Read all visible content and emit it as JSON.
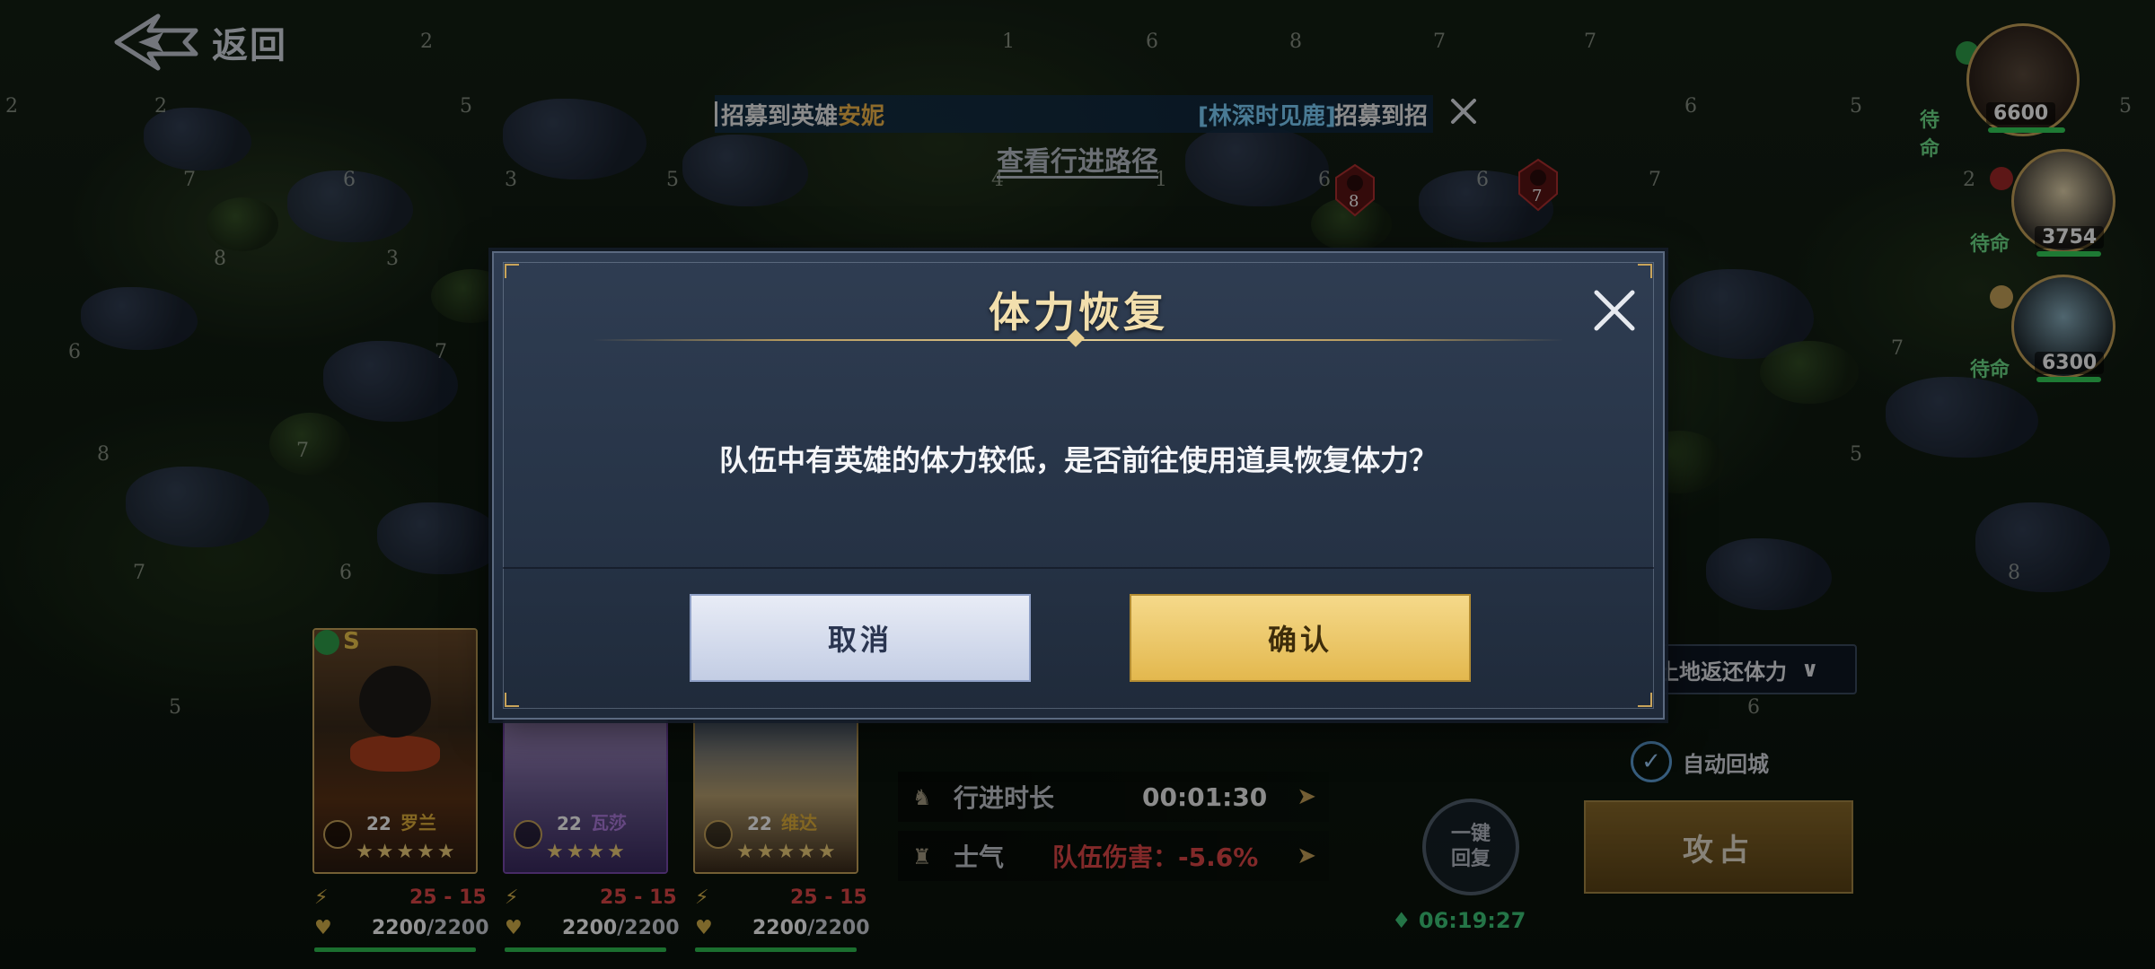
{
  "header": {
    "back_label": "返回"
  },
  "ticker": {
    "part1": "招募到英雄",
    "hero1": "安妮",
    "part2": "[林深时见鹿]",
    "part3": "招募到招"
  },
  "route_link": "查看行进路径",
  "map_numbers": [
    "2",
    "2",
    "5",
    "2",
    "7",
    "6",
    "3",
    "5",
    "8",
    "3",
    "6",
    "7",
    "7",
    "8",
    "6",
    "7",
    "6",
    "5",
    "7",
    "8",
    "1",
    "6",
    "8",
    "7",
    "7",
    "6",
    "1",
    "5",
    "2",
    "7",
    "6",
    "5",
    "8",
    "5",
    "6",
    "4",
    "1"
  ],
  "enemy_markers": [
    {
      "level": "8"
    },
    {
      "level": "7"
    }
  ],
  "troops": [
    {
      "status": "待命",
      "power": "6600"
    },
    {
      "status": "待命",
      "power": "3754"
    },
    {
      "status": "待命",
      "power": "6300"
    }
  ],
  "heroes": [
    {
      "level": "22",
      "name": "罗兰",
      "stars": "★★★★★",
      "range": "25 - 15",
      "hp": "2200",
      "hp_max": "/2200",
      "rarity": "S"
    },
    {
      "level": "22",
      "name": "瓦莎",
      "stars": "★★★★",
      "range": "25 - 15",
      "hp": "2200",
      "hp_max": "/2200"
    },
    {
      "level": "22",
      "name": "维达",
      "stars": "★★★★★",
      "range": "25 - 15",
      "hp": "2200",
      "hp_max": "/2200"
    }
  ],
  "march": {
    "duration_label": "行进时长",
    "duration_value": "00:01:30",
    "morale_label": "士气",
    "morale_value": "队伍伤害：-5.6%"
  },
  "land_return": "土地返还体力",
  "auto_return_label": "自动回城",
  "attack_label": "攻占",
  "onekey_label": "一键回复",
  "timer": "06:19:27",
  "dialog": {
    "title": "体力恢复",
    "message": "队伍中有英雄的体力较低，是否前往使用道具恢复体力？",
    "cancel_label": "取消",
    "confirm_label": "确认"
  },
  "colors": {
    "gold": "#e3b84e",
    "hero_highlight": "#f5b94a",
    "player_name": "#7fd3ff",
    "morale_negative": "#e04848",
    "standby": "#6fe08a"
  }
}
